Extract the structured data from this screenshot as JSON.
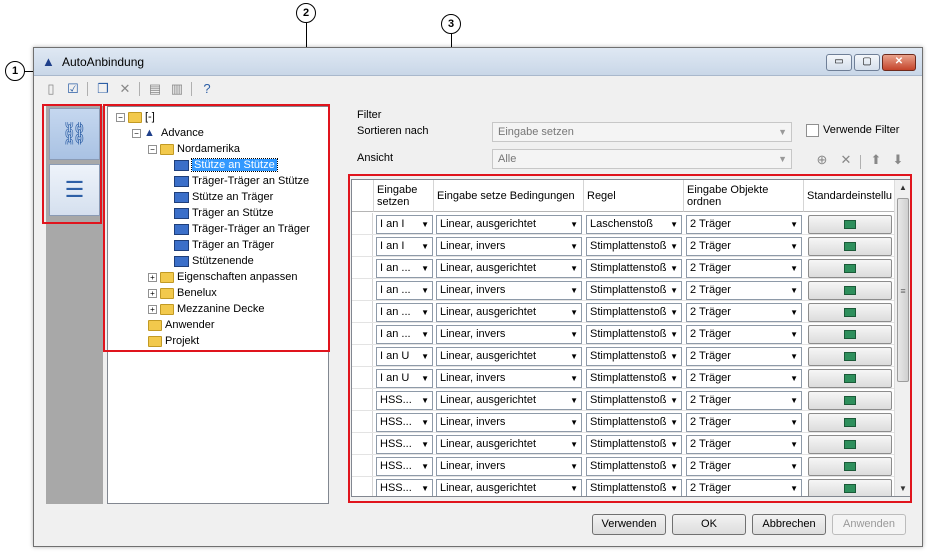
{
  "callouts": [
    "1",
    "2",
    "3"
  ],
  "window": {
    "title": "AutoAnbindung",
    "min": "▭",
    "max": "▢",
    "close": "✕"
  },
  "tree": {
    "root": "[-]",
    "advance": "Advance",
    "nordamerika": "Nordamerika",
    "items": [
      "Stütze an Stütze",
      "Träger-Träger an Stütze",
      "Stütze an Träger",
      "Träger an Stütze",
      "Träger-Träger an Träger",
      "Träger an Träger",
      "Stützenende"
    ],
    "groups": [
      "Eigenschaften anpassen",
      "Benelux",
      "Mezzanine Decke"
    ],
    "anwender": "Anwender",
    "projekt": "Projekt"
  },
  "filter": {
    "group_label": "Filter",
    "sort_label": "Sortieren nach",
    "sort_value": "Eingabe setzen",
    "view_label": "Ansicht",
    "view_value": "Alle",
    "use_filter_label": "Verwende Filter"
  },
  "grid": {
    "headers": [
      "Eingabe setzen",
      "Eingabe setze Bedingungen",
      "Regel",
      "Eingabe Objekte ordnen",
      "Standardeinstellu"
    ],
    "rows": [
      [
        "I an I",
        "Linear, ausgerichtet",
        "Laschenstoß",
        "2 Träger"
      ],
      [
        "I an I",
        "Linear, invers",
        "Stimplattenstoß",
        "2 Träger"
      ],
      [
        "I an ...",
        "Linear, ausgerichtet",
        "Stimplattenstoß",
        "2 Träger"
      ],
      [
        "I an ...",
        "Linear, invers",
        "Stimplattenstoß",
        "2 Träger"
      ],
      [
        "I an ...",
        "Linear, ausgerichtet",
        "Stimplattenstoß",
        "2 Träger"
      ],
      [
        "I an ...",
        "Linear, invers",
        "Stimplattenstoß",
        "2 Träger"
      ],
      [
        "I an U",
        "Linear, ausgerichtet",
        "Stimplattenstoß",
        "2 Träger"
      ],
      [
        "I an U",
        "Linear, invers",
        "Stimplattenstoß",
        "2 Träger"
      ],
      [
        "HSS...",
        "Linear, ausgerichtet",
        "Stimplattenstoß",
        "2 Träger"
      ],
      [
        "HSS...",
        "Linear, invers",
        "Stimplattenstoß",
        "2 Träger"
      ],
      [
        "HSS...",
        "Linear, ausgerichtet",
        "Stimplattenstoß",
        "2 Träger"
      ],
      [
        "HSS...",
        "Linear, invers",
        "Stimplattenstoß",
        "2 Träger"
      ],
      [
        "HSS...",
        "Linear, ausgerichtet",
        "Stimplattenstoß",
        "2 Träger"
      ]
    ]
  },
  "buttons": {
    "use": "Verwenden",
    "ok": "OK",
    "cancel": "Abbrechen",
    "apply": "Anwenden"
  },
  "colors": {
    "highlight": "#e0141d",
    "selection": "#3399ff"
  }
}
